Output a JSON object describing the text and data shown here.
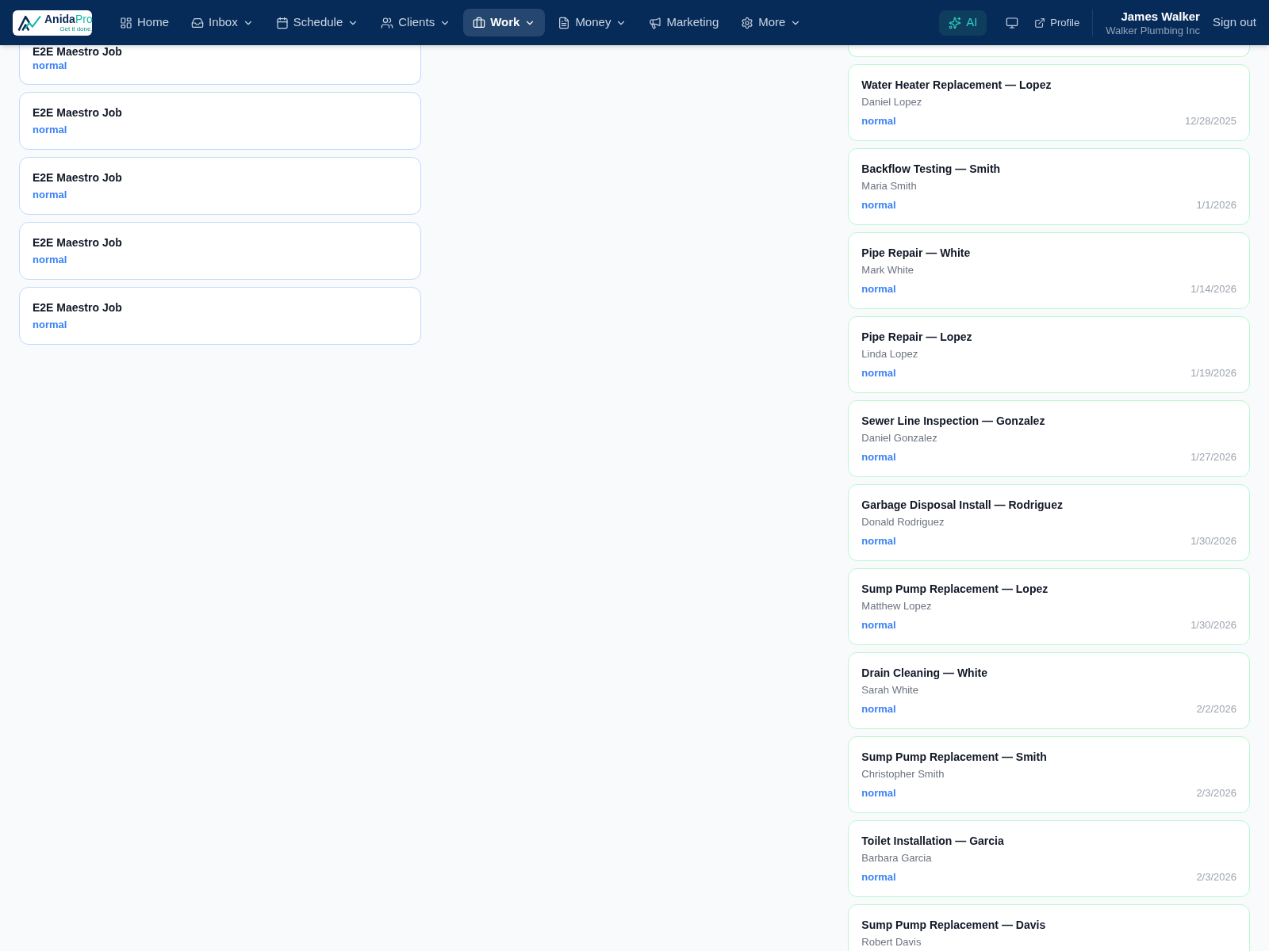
{
  "nav": {
    "logo": {
      "name": "Anida",
      "accent": "Pro",
      "tagline": "Get it done."
    },
    "items": [
      {
        "label": "Home",
        "selected": false,
        "has_menu": false
      },
      {
        "label": "Inbox",
        "selected": false,
        "has_menu": true
      },
      {
        "label": "Schedule",
        "selected": false,
        "has_menu": true
      },
      {
        "label": "Clients",
        "selected": false,
        "has_menu": true
      },
      {
        "label": "Work",
        "selected": true,
        "has_menu": true
      },
      {
        "label": "Money",
        "selected": false,
        "has_menu": true
      },
      {
        "label": "Marketing",
        "selected": false,
        "has_menu": false
      },
      {
        "label": "More",
        "selected": false,
        "has_menu": true
      }
    ],
    "ai_button": {
      "label": "AI"
    },
    "profile_link": {
      "label": "Profile"
    },
    "user": {
      "name": "James Walker",
      "company": "Walker Plumbing Inc"
    },
    "sign_out": {
      "label": "Sign out"
    }
  },
  "board": {
    "columns": [
      {
        "color": "#bfdbfe",
        "cards": [
          {
            "cut": true,
            "title": "E2E Maestro Job",
            "priority": "normal"
          },
          {
            "cut": false,
            "title": "E2E Maestro Job",
            "priority": "normal"
          },
          {
            "cut": false,
            "title": "E2E Maestro Job",
            "priority": "normal"
          },
          {
            "cut": false,
            "title": "E2E Maestro Job",
            "priority": "normal"
          },
          {
            "cut": false,
            "title": "E2E Maestro Job",
            "priority": "normal"
          }
        ]
      },
      {
        "color": "#bbf7d0",
        "cards": [
          {
            "cut": true
          },
          {
            "cut": false,
            "title": "Water Heater Replacement — Lopez",
            "client": "Daniel Lopez",
            "priority": "normal",
            "date": "12/28/2025"
          },
          {
            "cut": false,
            "title": "Backflow Testing — Smith",
            "client": "Maria Smith",
            "priority": "normal",
            "date": "1/1/2026"
          },
          {
            "cut": false,
            "title": "Pipe Repair — White",
            "client": "Mark White",
            "priority": "normal",
            "date": "1/14/2026"
          },
          {
            "cut": false,
            "title": "Pipe Repair — Lopez",
            "client": "Linda Lopez",
            "priority": "normal",
            "date": "1/19/2026"
          },
          {
            "cut": false,
            "title": "Sewer Line Inspection — Gonzalez",
            "client": "Daniel Gonzalez",
            "priority": "normal",
            "date": "1/27/2026"
          },
          {
            "cut": false,
            "title": "Garbage Disposal Install — Rodriguez",
            "client": "Donald Rodriguez",
            "priority": "normal",
            "date": "1/30/2026"
          },
          {
            "cut": false,
            "title": "Sump Pump Replacement — Lopez",
            "client": "Matthew Lopez",
            "priority": "normal",
            "date": "1/30/2026"
          },
          {
            "cut": false,
            "title": "Drain Cleaning — White",
            "client": "Sarah White",
            "priority": "normal",
            "date": "2/2/2026"
          },
          {
            "cut": false,
            "title": "Sump Pump Replacement — Smith",
            "client": "Christopher Smith",
            "priority": "normal",
            "date": "2/3/2026"
          },
          {
            "cut": false,
            "title": "Toilet Installation — Garcia",
            "client": "Barbara Garcia",
            "priority": "normal",
            "date": "2/3/2026"
          },
          {
            "cut": false,
            "title": "Sump Pump Replacement — Davis",
            "client": "Robert Davis"
          }
        ]
      }
    ]
  }
}
